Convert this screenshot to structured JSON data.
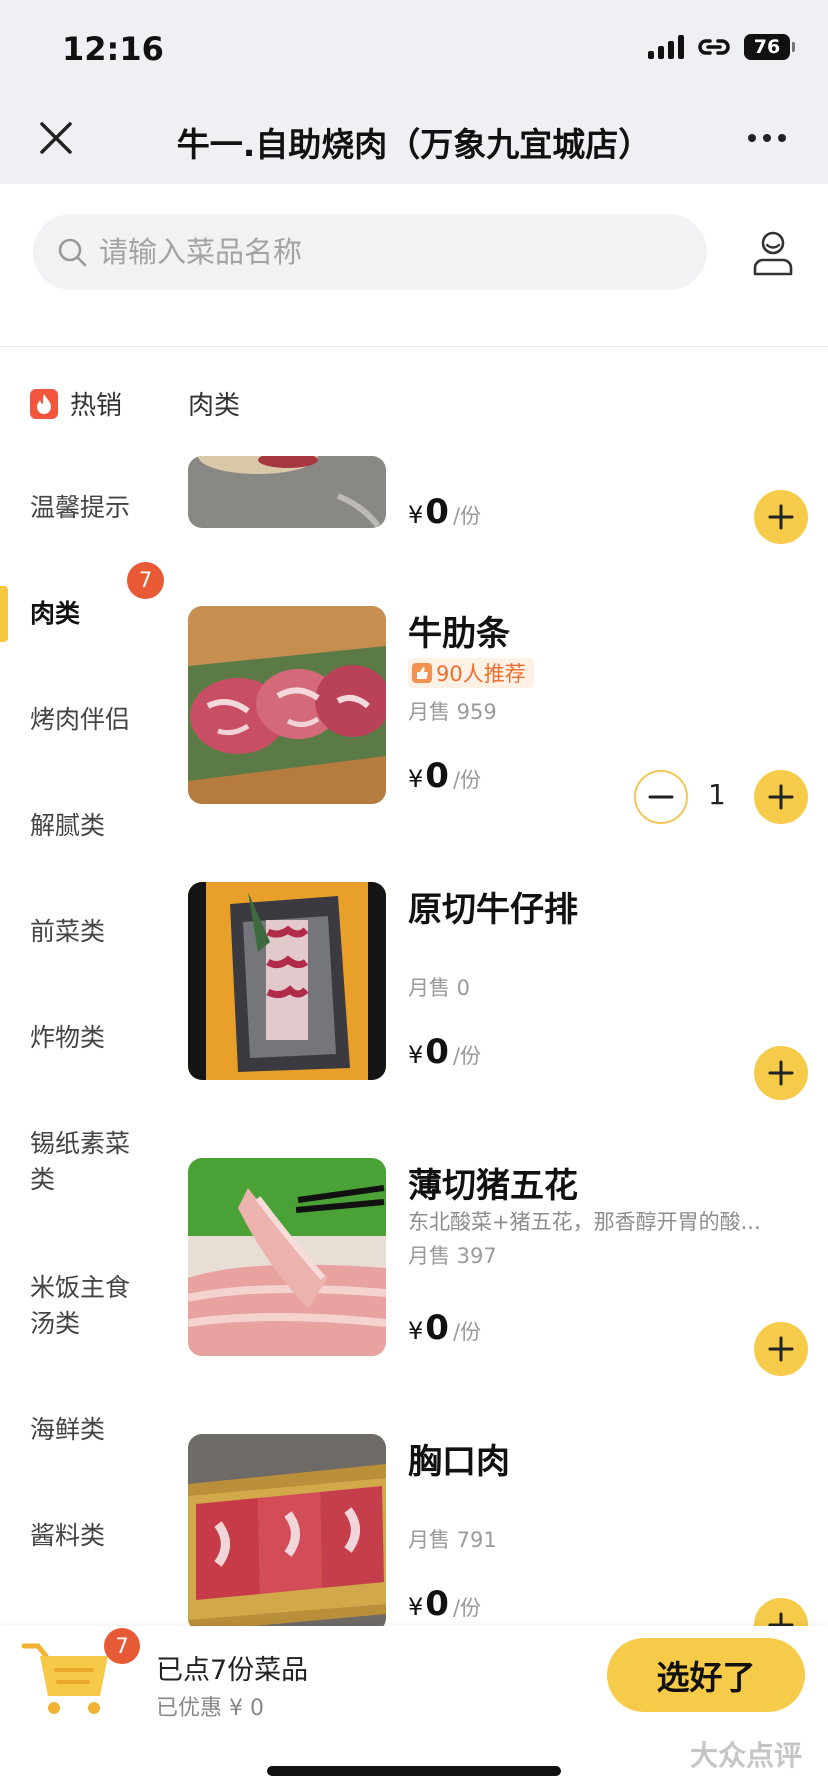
{
  "status_bar": {
    "time": "12:16",
    "battery": "76"
  },
  "header": {
    "title": "牛一.自助烧肉（万象九宜城店）"
  },
  "search": {
    "placeholder": "请输入菜品名称"
  },
  "section_labels": {
    "hot": "热销",
    "current": "肉类"
  },
  "sidebar": {
    "items": [
      {
        "label": "温馨提示"
      },
      {
        "label": "肉类",
        "badge": "7"
      },
      {
        "label": "烤肉伴侣"
      },
      {
        "label": "解腻类"
      },
      {
        "label": "前菜类"
      },
      {
        "label": "炸物类"
      },
      {
        "label": "锡纸素菜类"
      },
      {
        "label": "米饭主食汤类"
      },
      {
        "label": "海鲜类"
      },
      {
        "label": "酱料类"
      }
    ]
  },
  "dishes": [
    {
      "name": "",
      "price_yen": "¥",
      "price": "0",
      "unit": "/份"
    },
    {
      "name": "牛肋条",
      "recommend": "90人推荐",
      "sales": "月售 959",
      "price_yen": "¥",
      "price": "0",
      "unit": "/份",
      "quantity": "1"
    },
    {
      "name": "原切牛仔排",
      "sales": "月售 0",
      "price_yen": "¥",
      "price": "0",
      "unit": "/份"
    },
    {
      "name": "薄切猪五花",
      "desc": "东北酸菜+猪五花，那香醇开胃的酸...",
      "sales": "月售 397",
      "price_yen": "¥",
      "price": "0",
      "unit": "/份"
    },
    {
      "name": "胸口肉",
      "sales": "月售 791",
      "price_yen": "¥",
      "price": "0",
      "unit": "/份"
    }
  ],
  "cart": {
    "badge": "7",
    "count_text": "已点7份菜品",
    "discount_text": "已优惠 ¥ 0",
    "checkout_label": "选好了"
  },
  "watermark": "大众点评",
  "colors": {
    "accent_yellow": "#f7cb4a",
    "badge_red": "#e85a35",
    "recommend_orange": "#f06e2b"
  }
}
